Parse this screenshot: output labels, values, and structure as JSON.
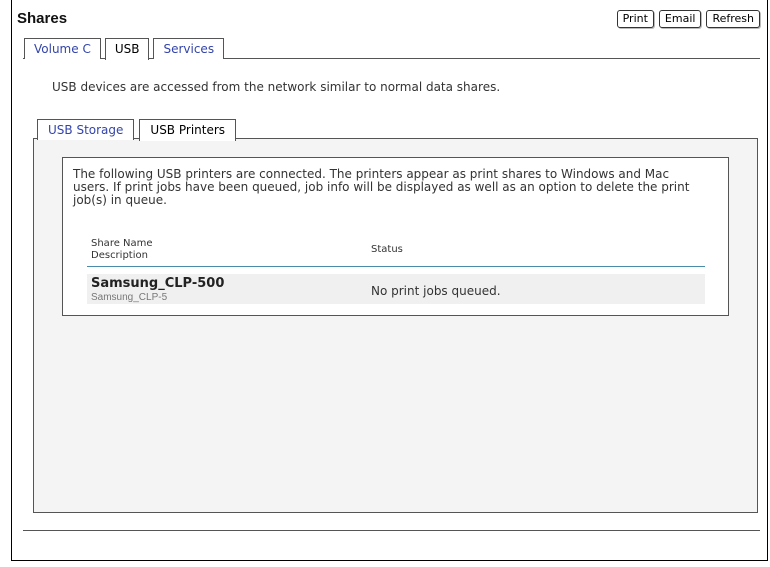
{
  "header": {
    "title": "Shares",
    "buttons": {
      "print": "Print",
      "email": "Email",
      "refresh": "Refresh"
    }
  },
  "tabs": [
    {
      "label": "Volume C",
      "active": false
    },
    {
      "label": "USB",
      "active": true
    },
    {
      "label": "Services",
      "active": false
    }
  ],
  "intro_text": "USB devices are accessed from the network similar to normal data shares.",
  "subtabs": [
    {
      "label": "USB Storage",
      "active": false
    },
    {
      "label": "USB Printers",
      "active": true
    }
  ],
  "info": {
    "line1": "The following USB printers are connected. The printers appear as print shares to Windows and Mac",
    "line2": "users. If print jobs have been queued, job info will be displayed as well as an option to delete the print",
    "line3": "job(s) in queue."
  },
  "table": {
    "col1_line1": "Share Name",
    "col1_line2": "Description",
    "col2": "Status",
    "rows": [
      {
        "name": "Samsung_CLP-500",
        "description": "Samsung_CLP-5",
        "status": "No print jobs queued."
      }
    ]
  },
  "colors": {
    "link": "#3344aa",
    "table_rule": "#4a8aaa",
    "panel_bg": "#f4f4f4"
  }
}
